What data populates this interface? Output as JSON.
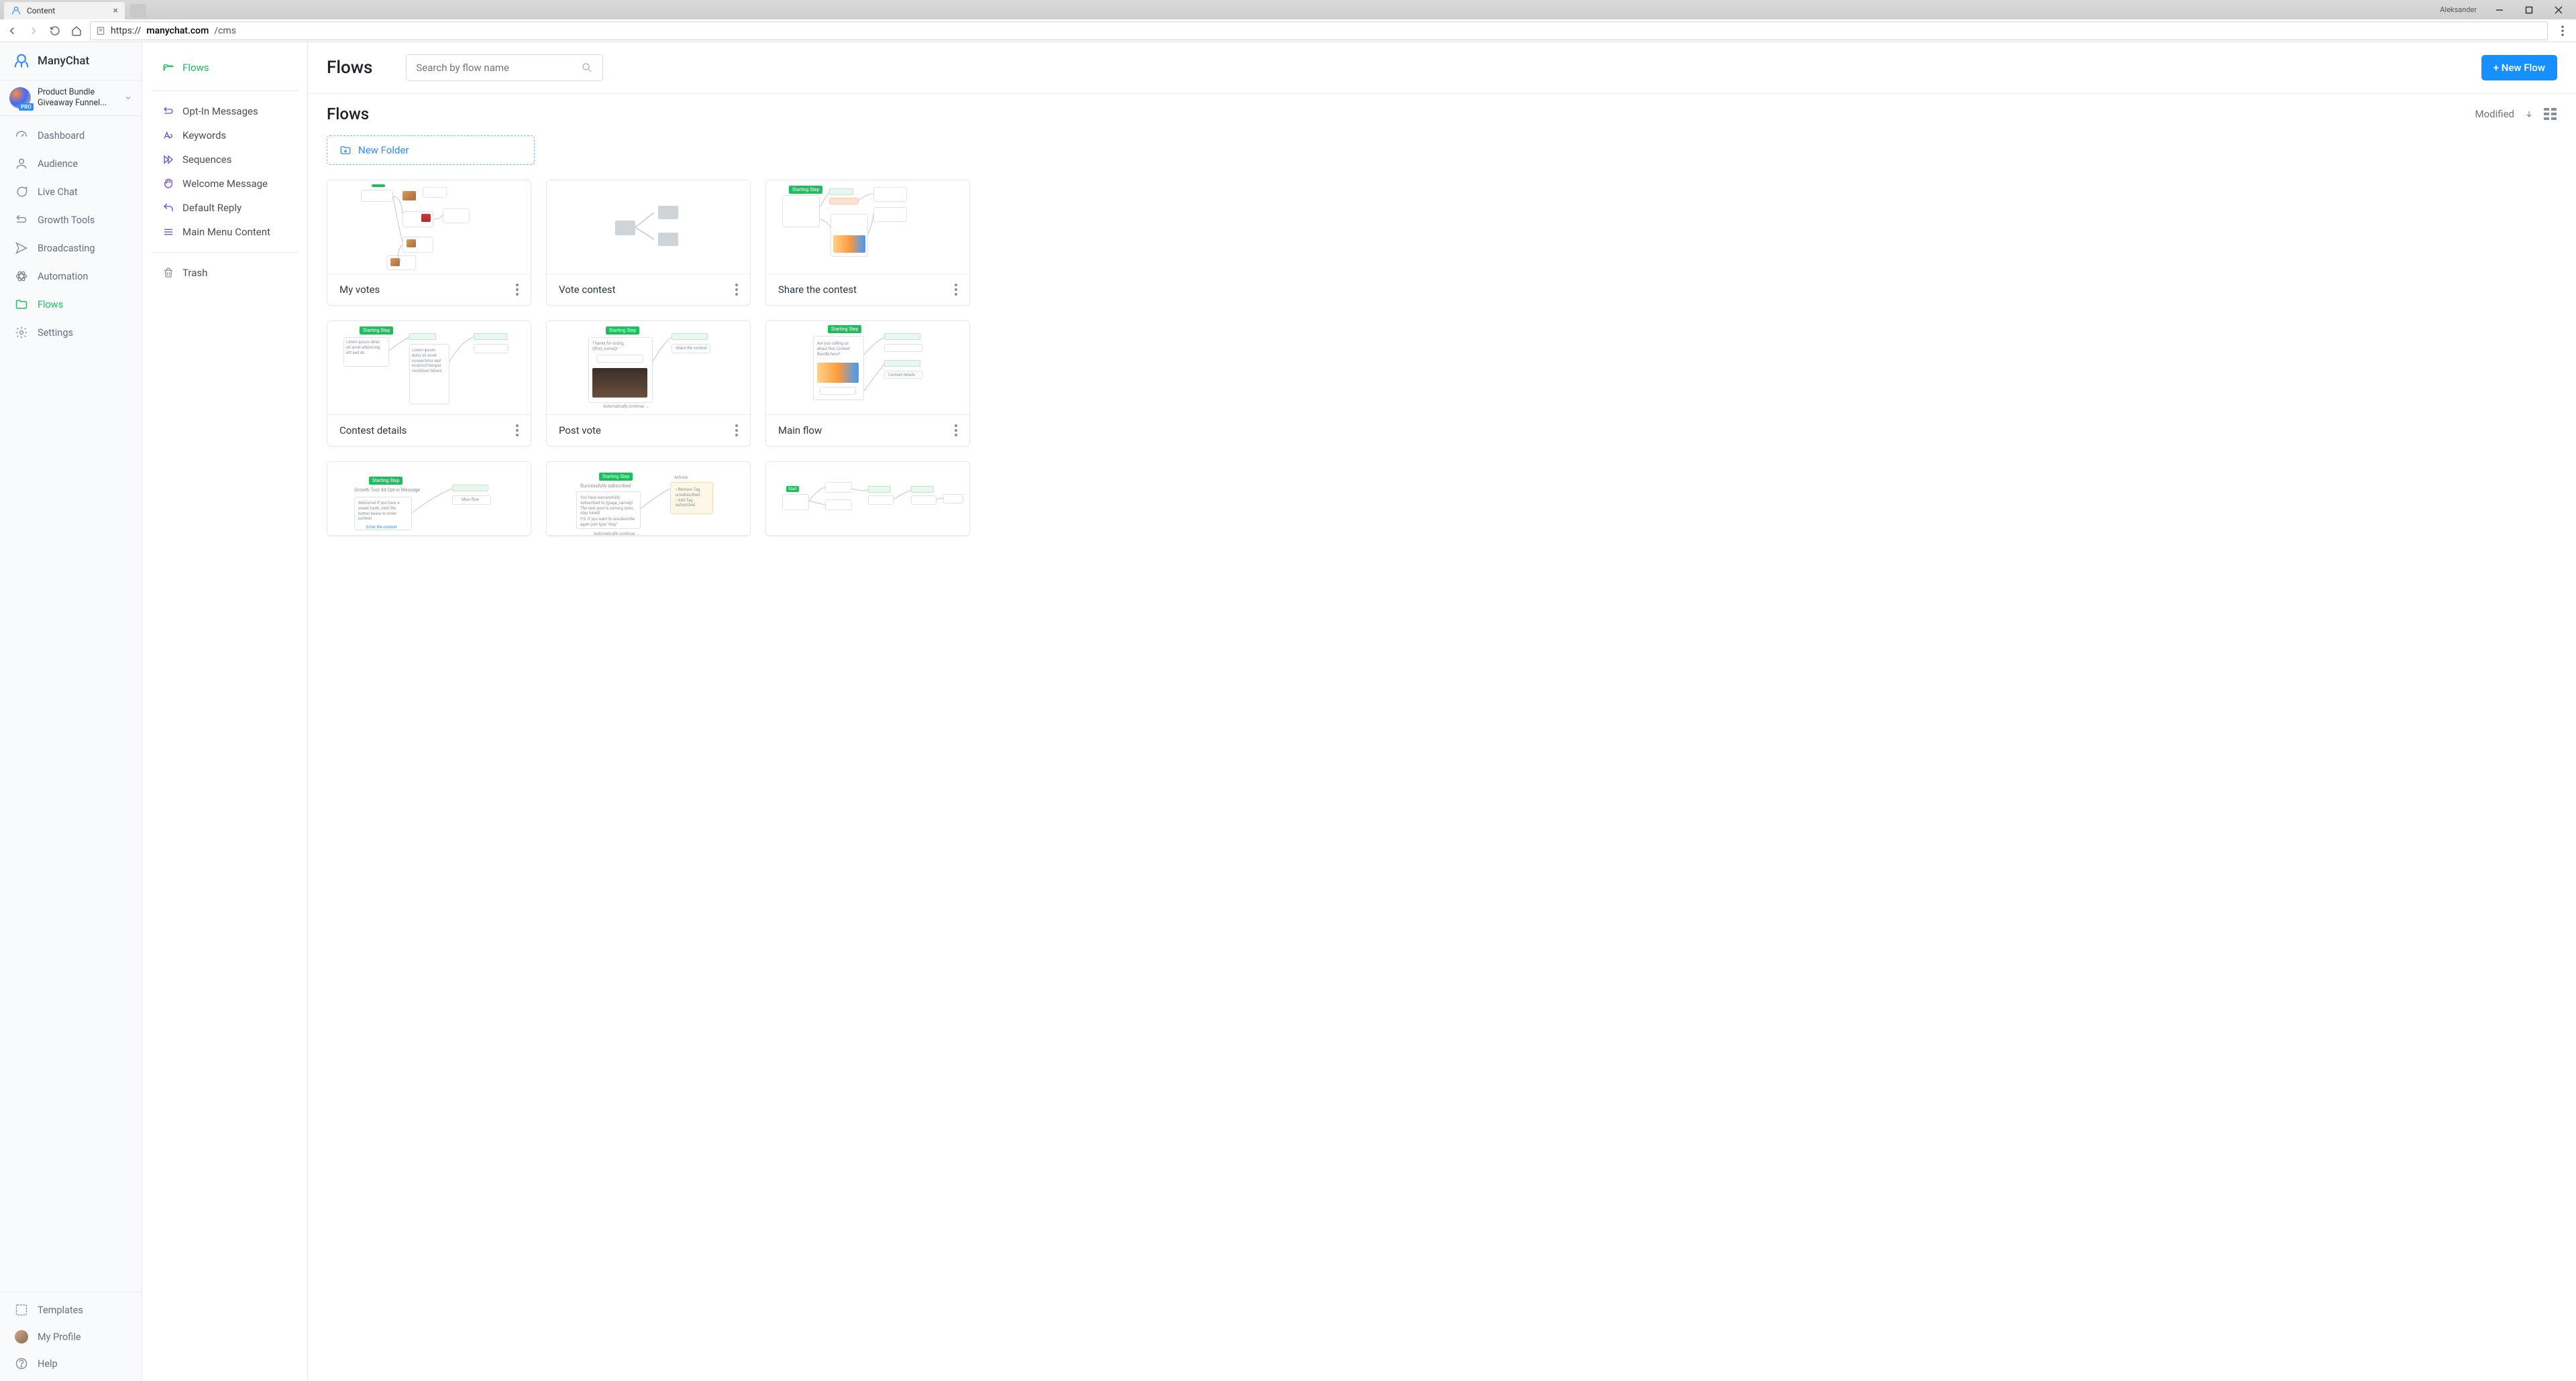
{
  "browser": {
    "tab_title": "Content",
    "user": "Aleksander",
    "url_host": "manychat.com",
    "url_path": "/cms",
    "url_scheme": "https://"
  },
  "brand": "ManyChat",
  "account": {
    "name": "Product Bundle Giveaway Funnel..."
  },
  "sidebar": {
    "items": [
      {
        "label": "Dashboard"
      },
      {
        "label": "Audience"
      },
      {
        "label": "Live Chat"
      },
      {
        "label": "Growth Tools"
      },
      {
        "label": "Broadcasting"
      },
      {
        "label": "Automation"
      },
      {
        "label": "Flows"
      },
      {
        "label": "Settings"
      }
    ],
    "bottom": [
      {
        "label": "Templates"
      },
      {
        "label": "My Profile"
      },
      {
        "label": "Help"
      }
    ]
  },
  "sub": {
    "flows": "Flows",
    "items": [
      {
        "label": "Opt-In Messages"
      },
      {
        "label": "Keywords"
      },
      {
        "label": "Sequences"
      },
      {
        "label": "Welcome Message"
      },
      {
        "label": "Default Reply"
      },
      {
        "label": "Main Menu Content"
      }
    ],
    "trash": "Trash"
  },
  "main": {
    "title": "Flows",
    "search_placeholder": "Search by flow name",
    "new_flow": "+ New Flow",
    "section": "Flows",
    "sort": "Modified",
    "new_folder": "New Folder",
    "cards": [
      {
        "title": "My votes"
      },
      {
        "title": "Vote contest"
      },
      {
        "title": "Share the contest"
      },
      {
        "title": "Contest details"
      },
      {
        "title": "Post vote"
      },
      {
        "title": "Main flow"
      },
      {
        "title": ""
      },
      {
        "title": ""
      },
      {
        "title": ""
      }
    ]
  }
}
